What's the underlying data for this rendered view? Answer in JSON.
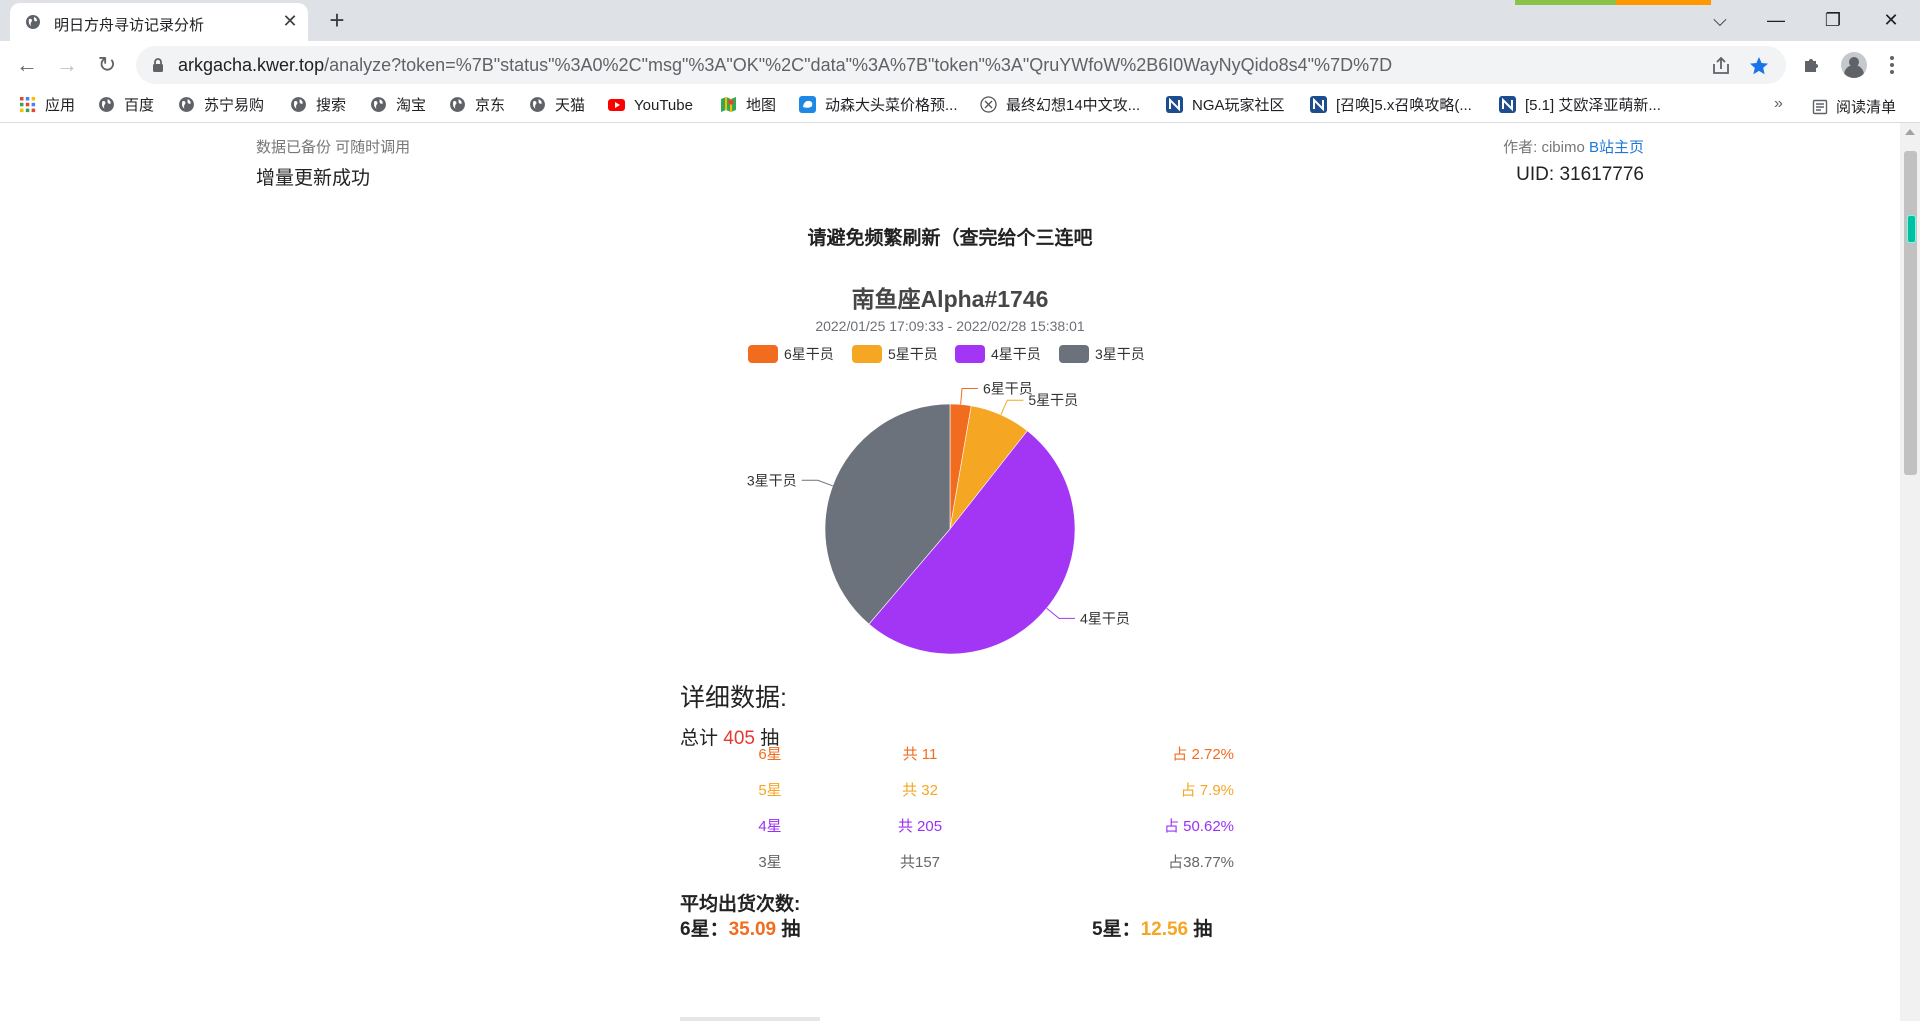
{
  "browser": {
    "tab_title": "明日方舟寻访记录分析",
    "tab_close": "✕",
    "new_tab": "+",
    "window_controls": {
      "chevron": "⌵",
      "minimize": "—",
      "restore": "❐",
      "close": "✕"
    },
    "url_host": "arkgacha.kwer.top",
    "url_rest": "/analyze?token=%7B\"status\"%3A0%2C\"msg\"%3A\"OK\"%2C\"data\"%3A%7B\"token\"%3A\"QruYWfoW%2B6I0WayNyQido8s4\"%7D%7D",
    "nav": {
      "back": "←",
      "forward": "→",
      "reload": "↻"
    }
  },
  "bookmarks": {
    "items": [
      {
        "label": "应用",
        "icon": "apps-grid-icon"
      },
      {
        "label": "百度",
        "icon": "globe-icon"
      },
      {
        "label": "苏宁易购",
        "icon": "globe-icon"
      },
      {
        "label": "搜索",
        "icon": "globe-icon"
      },
      {
        "label": "淘宝",
        "icon": "globe-icon"
      },
      {
        "label": "京东",
        "icon": "globe-icon"
      },
      {
        "label": "天猫",
        "icon": "globe-icon"
      },
      {
        "label": "YouTube",
        "icon": "youtube-icon"
      },
      {
        "label": "地图",
        "icon": "maps-icon"
      },
      {
        "label": "动森大头菜价格预...",
        "icon": "bird-icon"
      },
      {
        "label": "最终幻想14中文攻...",
        "icon": "emblem-icon"
      },
      {
        "label": "NGA玩家社区",
        "icon": "nga-icon"
      },
      {
        "label": "[召唤]5.x召唤攻略(...",
        "icon": "nga-icon"
      },
      {
        "label": "[5.1] 艾欧泽亚萌新...",
        "icon": "nga-icon"
      }
    ],
    "more": "»",
    "reading_list": "阅读清单"
  },
  "page": {
    "backup_note": "数据已备份 可随时调用",
    "update_status": "增量更新成功",
    "author_prefix": "作者: cibimo",
    "author_link": "B站主页",
    "uid": "UID: 31617776",
    "notice": "请避免频繁刷新（查完给个三连吧",
    "details_heading": "详细数据:",
    "total_prefix": "总计",
    "total_count": "405",
    "total_suffix": "抽",
    "stats": [
      {
        "star": "6星",
        "count": "共 11",
        "pct": "占 2.72%",
        "color": "#f26c1f"
      },
      {
        "star": "5星",
        "count": "共 32",
        "pct": "占 7.9%",
        "color": "#f5a623"
      },
      {
        "star": "4星",
        "count": "共 205",
        "pct": "占 50.62%",
        "color": "#9b30f5"
      },
      {
        "star": "3星",
        "count": "共157",
        "pct": "占38.77%",
        "color": "#666666"
      }
    ],
    "avg_heading": "平均出货次数:",
    "avg6_label": "6星：",
    "avg6_value": "35.09",
    "avg6_unit": "抽",
    "avg5_label": "5星：",
    "avg5_value": "12.56",
    "avg5_unit": "抽"
  },
  "chart_data": {
    "type": "pie",
    "title": "南鱼座Alpha#1746",
    "subtitle": "2022/01/25 17:09:33 - 2022/02/28 15:38:01",
    "legend_position": "top",
    "categories": [
      "6星干员",
      "5星干员",
      "4星干员",
      "3星干员"
    ],
    "values": [
      11,
      32,
      205,
      157
    ],
    "colors": [
      "#f26c1f",
      "#f5a623",
      "#a335f5",
      "#6b727b"
    ]
  }
}
